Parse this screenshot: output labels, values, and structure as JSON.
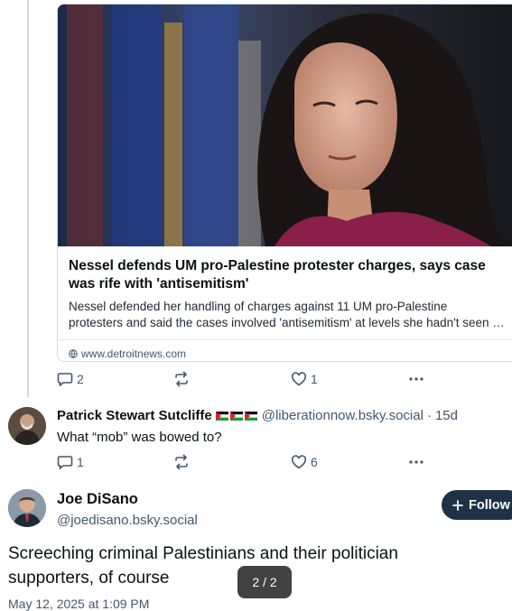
{
  "link_card": {
    "title": "Nessel defends UM pro-Palestine protester charges, says case was rife with 'antisemitism'",
    "description_line1": "Nessel defended her handling of charges against 11 UM pro-Palestine",
    "description_line2": "protesters and said the cases involved 'antisemitism' at levels she hadn't seen before",
    "domain": "www.detroitnews.com",
    "image_alt": "photo-of-woman-at-hearing"
  },
  "parent_actions": {
    "reply_count": "2",
    "repost_count": "",
    "like_count": "1"
  },
  "reply_post": {
    "author_name": "Patrick Stewart Sutcliffe",
    "flag_count": 3,
    "handle": "@liberationnow.bsky.social",
    "separator": "·",
    "age": "15d",
    "text": "What “mob” was bowed to?",
    "reply_count": "1",
    "like_count": "6"
  },
  "main_post": {
    "author_name": "Joe DiSano",
    "handle": "@joedisano.bsky.social",
    "follow_label": "Follow",
    "text": "Screeching criminal Palestinians and their politician supporters, of course",
    "date": "May 12, 2025 at 1:09 PM"
  },
  "image_pager": "2 / 2",
  "colors": {
    "muted": "#42576c",
    "follow_bg": "#1f3245",
    "border": "#d4dbe2"
  }
}
